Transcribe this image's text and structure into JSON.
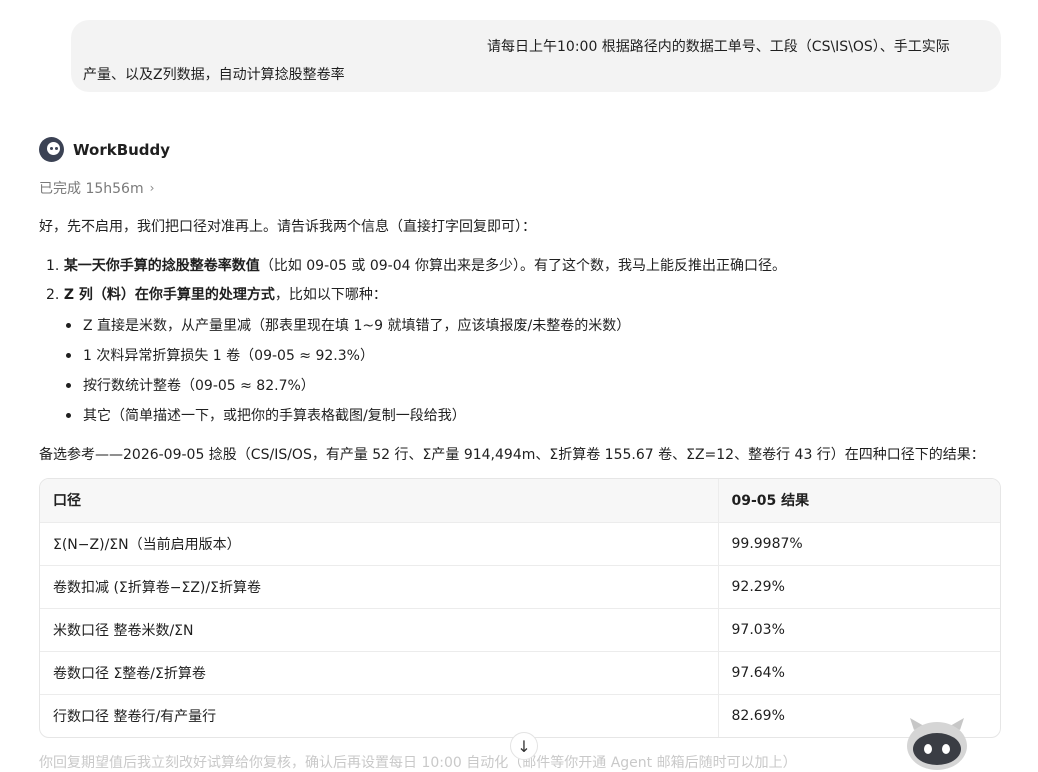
{
  "user_message": {
    "line1": "请每日上午10:00 根据路径内的数据工单号、工段（CS\\IS\\OS）、手工实际",
    "line2": "产量、以及Z列数据，自动计算捻股整卷率"
  },
  "assistant": {
    "name": "WorkBuddy",
    "status": "已完成 15h56m"
  },
  "intro": "好，先不启用，我们把口径对准再上。请告诉我两个信息（直接打字回复即可）：",
  "items": [
    {
      "num": "1.",
      "bold": "某一天你手算的捻股整卷率数值",
      "rest": "（比如 09-05 或 09-04 你算出来是多少）。有了这个数，我马上能反推出正确口径。"
    },
    {
      "num": "2.",
      "bold": "Z 列（料）在你手算里的处理方式",
      "rest": "，比如以下哪种："
    }
  ],
  "bullets": [
    "Z 直接是米数，从产量里减（那表里现在填 1~9 就填错了，应该填报废/未整卷的米数）",
    "1 次料异常折算损失 1 卷（09-05 ≈ 92.3%）",
    "按行数统计整卷（09-05 ≈ 82.7%）",
    "其它（简单描述一下，或把你的手算表格截图/复制一段给我）"
  ],
  "reference": "备选参考——2026-09-05 捻股（CS/IS/OS，有产量 52 行、Σ产量 914,494m、Σ折算卷 155.67 卷、ΣZ=12、整卷行 43 行）在四种口径下的结果：",
  "table": {
    "headers": [
      "口径",
      "09-05 结果"
    ],
    "rows": [
      [
        "Σ(N−Z)/ΣN（当前启用版本）",
        "99.9987%"
      ],
      [
        "卷数扣减 (Σ折算卷−ΣZ)/Σ折算卷",
        "92.29%"
      ],
      [
        "米数口径 整卷米数/ΣN",
        "97.03%"
      ],
      [
        "卷数口径 Σ整卷/Σ折算卷",
        "97.64%"
      ],
      [
        "行数口径 整卷行/有产量行",
        "82.69%"
      ]
    ]
  },
  "footer_faded": "你回复期望值后我立刻改好试算给你复核，确认后再设置每日 10:00 自动化（邮件等你开通 Agent 邮箱后随时可以加上）",
  "icons": {
    "avatar": "robot-avatar-icon",
    "status_chevron": "chevron-right-icon",
    "scroll": "arrow-down-icon",
    "mascot": "robot-mascot-icon"
  }
}
